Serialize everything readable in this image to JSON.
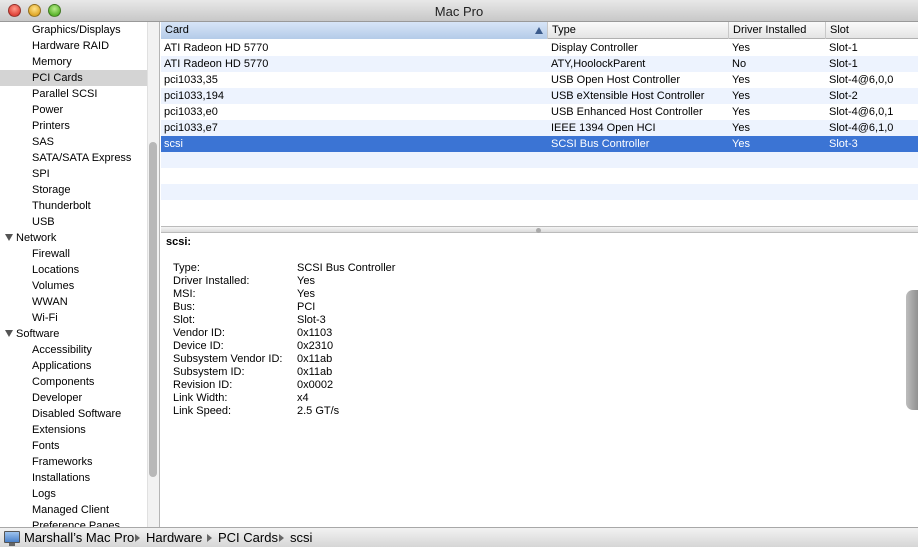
{
  "window": {
    "title": "Mac Pro"
  },
  "sidebar": {
    "items": [
      {
        "label": "Graphics/Displays",
        "group": false,
        "selected": false
      },
      {
        "label": "Hardware RAID",
        "group": false,
        "selected": false
      },
      {
        "label": "Memory",
        "group": false,
        "selected": false
      },
      {
        "label": "PCI Cards",
        "group": false,
        "selected": true
      },
      {
        "label": "Parallel SCSI",
        "group": false,
        "selected": false
      },
      {
        "label": "Power",
        "group": false,
        "selected": false
      },
      {
        "label": "Printers",
        "group": false,
        "selected": false
      },
      {
        "label": "SAS",
        "group": false,
        "selected": false
      },
      {
        "label": "SATA/SATA Express",
        "group": false,
        "selected": false
      },
      {
        "label": "SPI",
        "group": false,
        "selected": false
      },
      {
        "label": "Storage",
        "group": false,
        "selected": false
      },
      {
        "label": "Thunderbolt",
        "group": false,
        "selected": false
      },
      {
        "label": "USB",
        "group": false,
        "selected": false
      },
      {
        "label": "Network",
        "group": true,
        "selected": false
      },
      {
        "label": "Firewall",
        "group": false,
        "selected": false
      },
      {
        "label": "Locations",
        "group": false,
        "selected": false
      },
      {
        "label": "Volumes",
        "group": false,
        "selected": false
      },
      {
        "label": "WWAN",
        "group": false,
        "selected": false
      },
      {
        "label": "Wi-Fi",
        "group": false,
        "selected": false
      },
      {
        "label": "Software",
        "group": true,
        "selected": false
      },
      {
        "label": "Accessibility",
        "group": false,
        "selected": false
      },
      {
        "label": "Applications",
        "group": false,
        "selected": false
      },
      {
        "label": "Components",
        "group": false,
        "selected": false
      },
      {
        "label": "Developer",
        "group": false,
        "selected": false
      },
      {
        "label": "Disabled Software",
        "group": false,
        "selected": false
      },
      {
        "label": "Extensions",
        "group": false,
        "selected": false
      },
      {
        "label": "Fonts",
        "group": false,
        "selected": false
      },
      {
        "label": "Frameworks",
        "group": false,
        "selected": false
      },
      {
        "label": "Installations",
        "group": false,
        "selected": false
      },
      {
        "label": "Logs",
        "group": false,
        "selected": false
      },
      {
        "label": "Managed Client",
        "group": false,
        "selected": false
      },
      {
        "label": "Preference Panes",
        "group": false,
        "selected": false
      }
    ]
  },
  "table": {
    "columns": {
      "card": "Card",
      "type": "Type",
      "driver": "Driver Installed",
      "slot": "Slot"
    },
    "rows": [
      {
        "card": "ATI Radeon HD 5770",
        "type": "Display Controller",
        "driver": "Yes",
        "slot": "Slot-1",
        "selected": false
      },
      {
        "card": "ATI Radeon HD 5770",
        "type": "ATY,HoolockParent",
        "driver": "No",
        "slot": "Slot-1",
        "selected": false
      },
      {
        "card": "pci1033,35",
        "type": "USB Open Host Controller",
        "driver": "Yes",
        "slot": "Slot-4@6,0,0",
        "selected": false
      },
      {
        "card": "pci1033,194",
        "type": "USB eXtensible Host Controller",
        "driver": "Yes",
        "slot": "Slot-2",
        "selected": false
      },
      {
        "card": "pci1033,e0",
        "type": "USB Enhanced Host Controller",
        "driver": "Yes",
        "slot": "Slot-4@6,0,1",
        "selected": false
      },
      {
        "card": "pci1033,e7",
        "type": "IEEE 1394 Open HCI",
        "driver": "Yes",
        "slot": "Slot-4@6,1,0",
        "selected": false
      },
      {
        "card": "scsi",
        "type": "SCSI Bus Controller",
        "driver": "Yes",
        "slot": "Slot-3",
        "selected": true
      }
    ]
  },
  "detail": {
    "title": "scsi:",
    "fields": [
      {
        "key": "Type:",
        "value": "SCSI Bus Controller"
      },
      {
        "key": "Driver Installed:",
        "value": "Yes"
      },
      {
        "key": "MSI:",
        "value": "Yes"
      },
      {
        "key": "Bus:",
        "value": "PCI"
      },
      {
        "key": "Slot:",
        "value": "Slot-3"
      },
      {
        "key": "Vendor ID:",
        "value": "0x1103"
      },
      {
        "key": "Device ID:",
        "value": "0x2310"
      },
      {
        "key": "Subsystem Vendor ID:",
        "value": "0x11ab"
      },
      {
        "key": "Subsystem ID:",
        "value": "0x11ab"
      },
      {
        "key": "Revision ID:",
        "value": "0x0002"
      },
      {
        "key": "Link Width:",
        "value": "x4"
      },
      {
        "key": "Link Speed:",
        "value": "2.5 GT/s"
      }
    ]
  },
  "pathbar": {
    "crumbs": [
      "Marshall’s Mac Pro",
      "Hardware",
      "PCI Cards",
      "scsi"
    ]
  },
  "icons": {
    "computer": "computer-icon",
    "disclosure": "disclosure-triangle-icon",
    "sort": "sort-ascending-icon"
  }
}
